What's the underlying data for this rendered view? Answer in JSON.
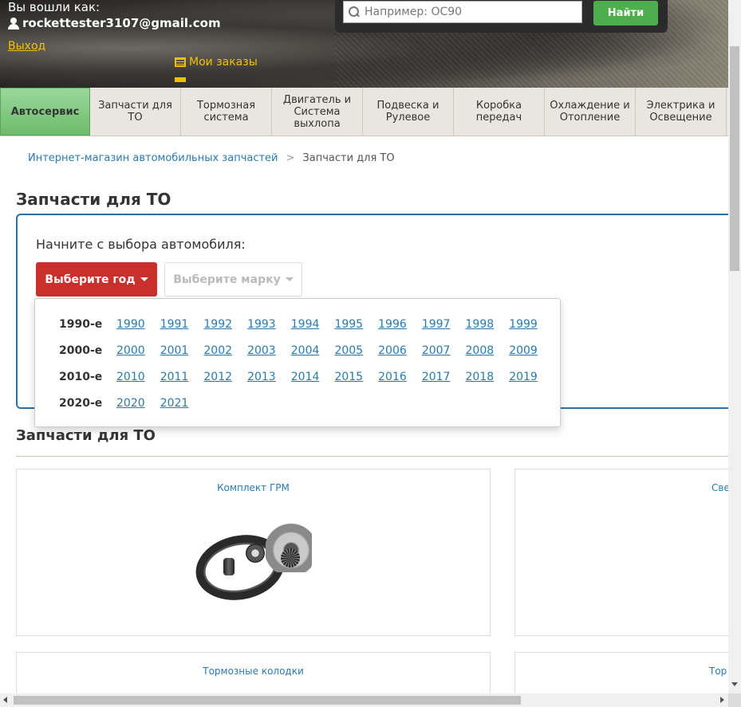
{
  "header": {
    "logged_in_label": "Вы вошли как:",
    "user_email": "rockettester3107@gmail.com",
    "logout_label": "Выход",
    "orders_label": "Мои заказы"
  },
  "search": {
    "placeholder": "Например: OC90",
    "button_label": "Найти"
  },
  "nav": {
    "items": [
      {
        "label": "Автосервис",
        "active": true
      },
      {
        "label": "Запчасти для ТО"
      },
      {
        "label": "Тормозная система"
      },
      {
        "label": "Двигатель и Система выхлопа"
      },
      {
        "label": "Подвеска и Рулевое"
      },
      {
        "label": "Коробка передач"
      },
      {
        "label": "Охлаждение и Отопление"
      },
      {
        "label": "Электрика и Освещение"
      }
    ]
  },
  "breadcrumb": {
    "home": "Интернет-магазин автомобильных запчастей",
    "separator": ">",
    "current": "Запчасти для ТО"
  },
  "page_title": "Запчасти для ТО",
  "selector": {
    "prompt": "Начните с выбора автомобиля:",
    "year_button": "Выберите год",
    "brand_button": "Выберите марку"
  },
  "year_dropdown": {
    "decades": [
      {
        "label": "1990-е",
        "years": [
          "1990",
          "1991",
          "1992",
          "1993",
          "1994",
          "1995",
          "1996",
          "1997",
          "1998",
          "1999"
        ]
      },
      {
        "label": "2000-е",
        "years": [
          "2000",
          "2001",
          "2002",
          "2003",
          "2004",
          "2005",
          "2006",
          "2007",
          "2008",
          "2009"
        ]
      },
      {
        "label": "2010-е",
        "years": [
          "2010",
          "2011",
          "2012",
          "2013",
          "2014",
          "2015",
          "2016",
          "2017",
          "2018",
          "2019"
        ]
      },
      {
        "label": "2020-е",
        "years": [
          "2020",
          "2021"
        ]
      }
    ]
  },
  "section": {
    "title": "Запчасти для ТО",
    "cards": [
      {
        "title": "Комплект ГРМ",
        "icon": "timing-belt-kit-image"
      },
      {
        "title": "Све"
      },
      {
        "title": "Тормозные колодки"
      },
      {
        "title": "Тор"
      }
    ]
  },
  "colors": {
    "active_nav": "#7ec87e",
    "year_button": "#c9302c",
    "search_button": "#4cae4c",
    "link": "#2a7ab0",
    "selector_border": "#2a6fa8",
    "header_accent": "#f0c000"
  }
}
